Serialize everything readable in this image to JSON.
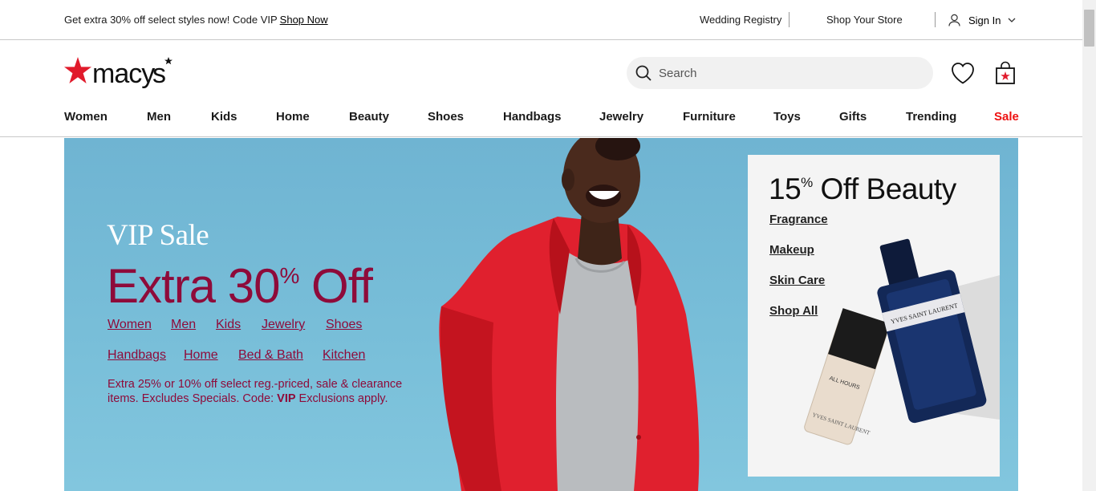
{
  "promo": {
    "text": "Get extra 30% off select styles now! Code VIP",
    "link": "Shop Now"
  },
  "utility": {
    "registry": "Wedding Registry",
    "store": "Shop Your Store",
    "signin": "Sign In"
  },
  "brand": {
    "name": "macy's",
    "color": "#e11a2b"
  },
  "search": {
    "placeholder": "Search",
    "value": ""
  },
  "nav": {
    "items": [
      "Women",
      "Men",
      "Kids",
      "Home",
      "Beauty",
      "Shoes",
      "Handbags",
      "Jewelry",
      "Furniture",
      "Toys",
      "Gifts",
      "Trending",
      "Sale"
    ]
  },
  "hero": {
    "eyebrow": "VIP Sale",
    "headline_a": "Extra 30",
    "headline_pct": "%",
    "headline_b": " Off",
    "links_row1": [
      "Women",
      "Men",
      "Kids",
      "Jewelry",
      "Shoes"
    ],
    "links_row2": [
      "Handbags",
      "Home",
      "Bed & Bath",
      "Kitchen"
    ],
    "fine_a": "Extra 25% or 10% off select reg.-priced, sale & clearance items. Excludes Specials. Code: ",
    "fine_code": "VIP",
    "fine_b": " Exclusions apply.",
    "accent": "#8e0b3a"
  },
  "beauty": {
    "title_a": "15",
    "title_pct": "%",
    "title_b": " Off Beauty",
    "links": [
      "Fragrance",
      "Makeup",
      "Skin Care",
      "Shop All"
    ]
  },
  "icons": [
    "search-icon",
    "user-icon",
    "chevron-down-icon",
    "heart-icon",
    "shopping-bag-icon",
    "macys-star-logo"
  ]
}
